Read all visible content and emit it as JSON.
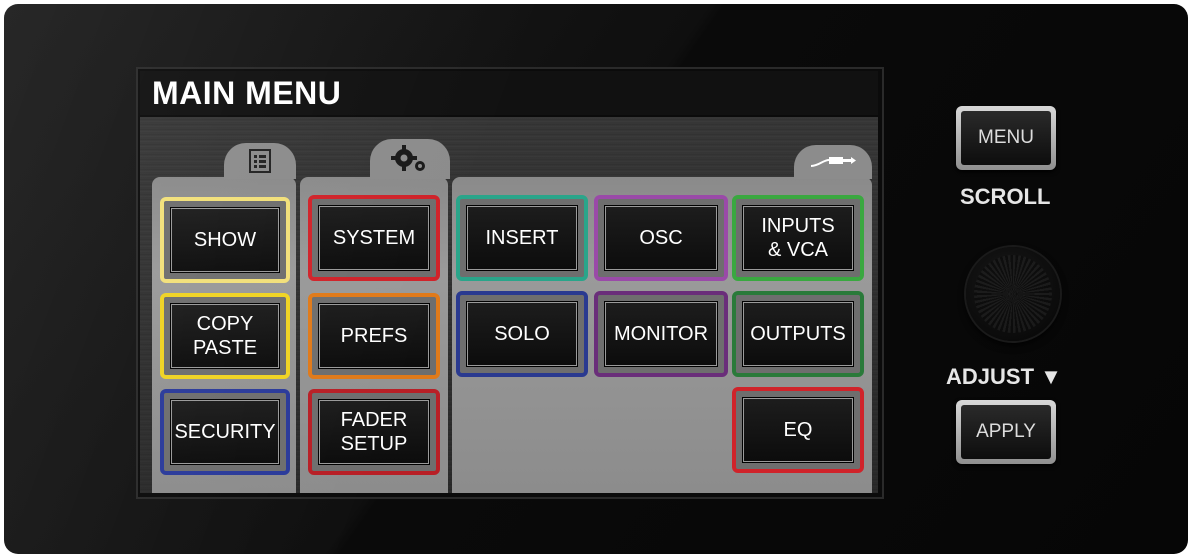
{
  "screen": {
    "title": "MAIN MENU"
  },
  "groups": {
    "show_icon": "list-document-icon",
    "system_icon": "gears-icon",
    "signal_icon": "cable-plug-icon"
  },
  "buttons": {
    "show": {
      "label": "SHOW",
      "color": "#f2e07a"
    },
    "copy_paste": {
      "label": "COPY\nPASTE",
      "color": "#f0d323"
    },
    "security": {
      "label": "SECURITY",
      "color": "#2a3a9a"
    },
    "system": {
      "label": "SYSTEM",
      "color": "#d0232a"
    },
    "prefs": {
      "label": "PREFS",
      "color": "#e07a1a"
    },
    "fader_setup": {
      "label": "FADER\nSETUP",
      "color": "#b81f26"
    },
    "insert": {
      "label": "INSERT",
      "color": "#2aa58a"
    },
    "osc": {
      "label": "OSC",
      "color": "#9a4aa8"
    },
    "inputs_vca": {
      "label": "INPUTS\n& VCA",
      "color": "#3aa840"
    },
    "solo": {
      "label": "SOLO",
      "color": "#2a3a90"
    },
    "monitor": {
      "label": "MONITOR",
      "color": "#6a2e7a"
    },
    "outputs": {
      "label": "OUTPUTS",
      "color": "#2a7a3a"
    },
    "eq": {
      "label": "EQ",
      "color": "#d0232a"
    }
  },
  "hardware": {
    "menu_button": "MENU",
    "scroll_label": "SCROLL",
    "adjust_label": "ADJUST ▼",
    "apply_button": "APPLY"
  }
}
